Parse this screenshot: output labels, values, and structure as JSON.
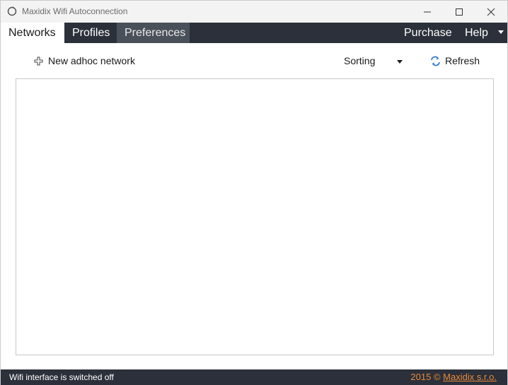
{
  "window": {
    "title": "Maxidix Wifi Autoconnection"
  },
  "tabs": [
    {
      "label": "Networks",
      "active": true
    },
    {
      "label": "Profiles",
      "active": false
    },
    {
      "label": "Preferences",
      "active": false
    }
  ],
  "menu": {
    "purchase": "Purchase",
    "help": "Help"
  },
  "toolbar": {
    "new_adhoc": "New adhoc network",
    "sorting": "Sorting",
    "refresh": "Refresh"
  },
  "status": {
    "message": "Wifi interface is switched off",
    "year": "2015",
    "copyright_symbol": "©",
    "company": "Maxidix s.r.o."
  },
  "colors": {
    "menubar_bg": "#2b303a",
    "copyright_accent": "#e8883a",
    "refresh_icon": "#3a7fd0"
  },
  "icons": {
    "app": "refresh-circle-icon",
    "new": "plus-icon",
    "refresh": "refresh-arrows-icon"
  }
}
